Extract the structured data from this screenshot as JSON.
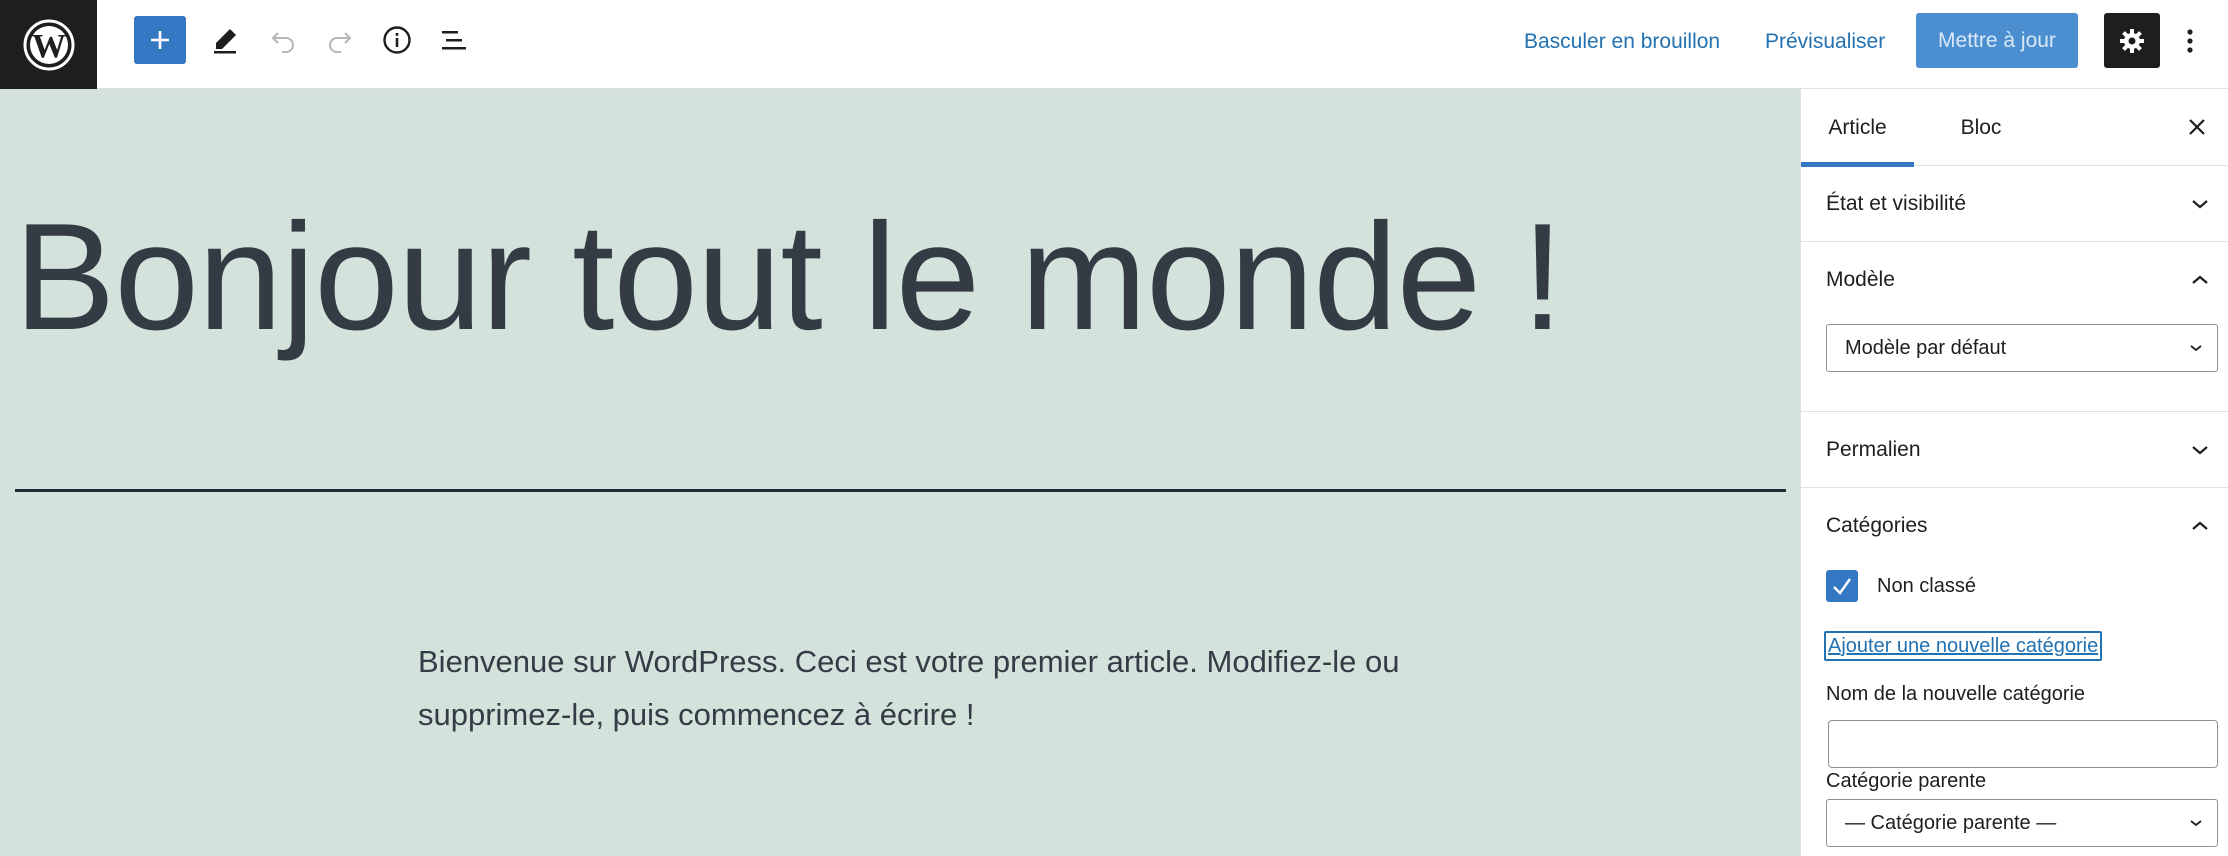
{
  "toolbar": {
    "logo": "wordpress-logo",
    "add_block_icon": "plus-icon",
    "tools_icon": "pencil-icon",
    "undo_icon": "undo-icon",
    "redo_icon": "redo-icon",
    "details_icon": "info-icon",
    "list_view_icon": "list-view-icon",
    "switch_draft_label": "Basculer en brouillon",
    "preview_label": "Prévisualiser",
    "update_label": "Mettre à jour",
    "settings_icon": "gear-icon",
    "more_icon": "vertical-ellipsis-icon"
  },
  "editor": {
    "title": "Bonjour tout le monde !",
    "paragraph": "Bienvenue sur WordPress. Ceci est votre premier article. Modifiez-le ou supprimez-le, puis commencez à écrire !",
    "background_color": "#d3e3dc"
  },
  "sidebar": {
    "tabs": [
      {
        "label": "Article",
        "active": true
      },
      {
        "label": "Bloc",
        "active": false
      }
    ],
    "panels": {
      "status": {
        "label": "État et visibilité",
        "expanded": false
      },
      "template": {
        "label": "Modèle",
        "expanded": true,
        "selected": "Modèle par défaut"
      },
      "permalink": {
        "label": "Permalien",
        "expanded": false
      },
      "categories": {
        "label": "Catégories",
        "expanded": true,
        "items": [
          {
            "label": "Non classé",
            "checked": true
          }
        ],
        "add_link": "Ajouter une nouvelle catégorie",
        "new_name_label": "Nom de la nouvelle catégorie",
        "new_name_value": "",
        "parent_label": "Catégorie parente",
        "parent_selected": "— Catégorie parente —"
      }
    }
  },
  "colors": {
    "accent": "#3477c3",
    "link": "#2271b1",
    "dark": "#1e1e1e"
  }
}
